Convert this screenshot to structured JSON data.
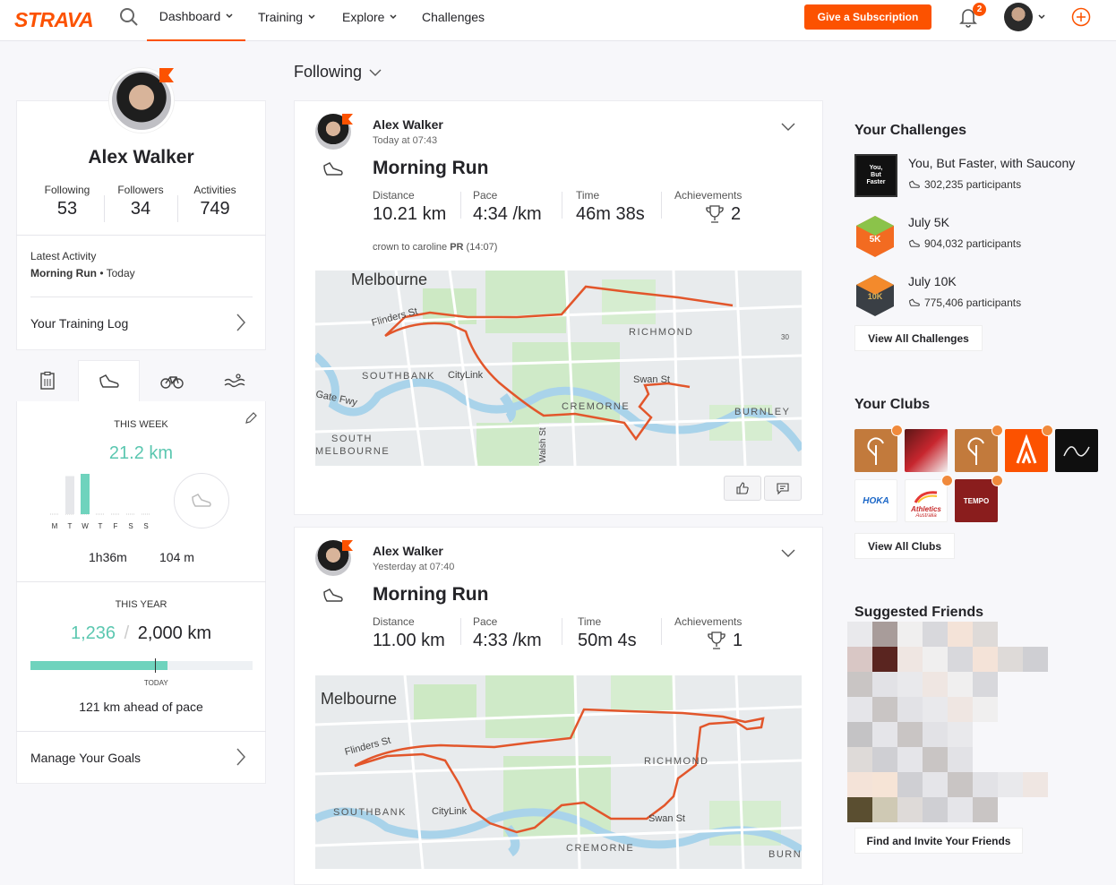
{
  "nav": {
    "logo": "STRAVA",
    "items": [
      "Dashboard",
      "Training",
      "Explore",
      "Challenges"
    ],
    "subscribe_label": "Give a Subscription",
    "notif_count": "2",
    "accent": "#fc5200"
  },
  "profile": {
    "name": "Alex Walker",
    "stats": [
      {
        "label": "Following",
        "value": "53"
      },
      {
        "label": "Followers",
        "value": "34"
      },
      {
        "label": "Activities",
        "value": "749"
      }
    ],
    "latest_label": "Latest Activity",
    "latest_activity": "Morning Run",
    "latest_when": " • Today",
    "training_log": "Your Training Log"
  },
  "week": {
    "heading": "THIS WEEK",
    "distance": "21.2 km",
    "days": [
      "M",
      "T",
      "W",
      "T",
      "F",
      "S",
      "S"
    ],
    "day_km_fraction": [
      0.0,
      0.85,
      0.9,
      0.0,
      0.0,
      0.0,
      0.0
    ],
    "time": "1h36m",
    "elevation": "104 m"
  },
  "year": {
    "heading": "THIS YEAR",
    "current": "1,236",
    "separator": "/",
    "goal": "2,000 km",
    "progress_fraction": 0.618,
    "today_fraction": 0.56,
    "today_label": "TODAY",
    "pace_text": "121 km ahead of pace",
    "manage_goals": "Manage Your Goals"
  },
  "feed": {
    "filter": "Following",
    "activities": [
      {
        "athlete": "Alex Walker",
        "when": "Today at 07:43",
        "title": "Morning Run",
        "metrics": [
          {
            "label": "Distance",
            "value": "10.21 km"
          },
          {
            "label": "Pace",
            "value": "4:34 /km"
          },
          {
            "label": "Time",
            "value": "46m 38s"
          }
        ],
        "achievements_label": "Achievements",
        "achievements": "2",
        "note_prefix": "crown to caroline ",
        "note_bold": "PR",
        "note_suffix": " (14:07)",
        "map_labels": {
          "city": "Melbourne",
          "flinders": "Flinders St",
          "richmond": "RICHMOND",
          "southbank": "SOUTHBANK",
          "citylink": "CityLink",
          "swan": "Swan St",
          "gate": "Gate Fwy",
          "cremorne": "CREMORNE",
          "burnley": "BURNLEY",
          "south": "SOUTH",
          "melb": "MELBOURNE",
          "walsh": "Walsh St",
          "n30": "30"
        }
      },
      {
        "athlete": "Alex Walker",
        "when": "Yesterday at 07:40",
        "title": "Morning Run",
        "metrics": [
          {
            "label": "Distance",
            "value": "11.00 km"
          },
          {
            "label": "Pace",
            "value": "4:33 /km"
          },
          {
            "label": "Time",
            "value": "50m 4s"
          }
        ],
        "achievements_label": "Achievements",
        "achievements": "1",
        "map_labels": {
          "city": "Melbourne",
          "flinders": "Flinders St",
          "richmond": "RICHMOND",
          "southbank": "SOUTHBANK",
          "citylink": "CityLink",
          "swan": "Swan St",
          "cremorne": "CREMORNE",
          "burn": "BURN"
        }
      }
    ]
  },
  "challenges": {
    "heading": "Your Challenges",
    "items": [
      {
        "name": "You, But Faster, with Saucony",
        "participants": "302,235 participants",
        "badge": "You, But Faster"
      },
      {
        "name": "July 5K",
        "participants": "904,032 participants",
        "badge": "5K"
      },
      {
        "name": "July 10K",
        "participants": "775,406 participants",
        "badge": "10K"
      }
    ],
    "view_all": "View All Challenges"
  },
  "clubs": {
    "heading": "Your Clubs",
    "club_labels": [
      "HOKA",
      "Athletics",
      "Australia",
      "TEMPO"
    ],
    "view_all": "View All Clubs"
  },
  "friends": {
    "heading": "Suggested Friends",
    "invite": "Find and Invite Your Friends"
  }
}
